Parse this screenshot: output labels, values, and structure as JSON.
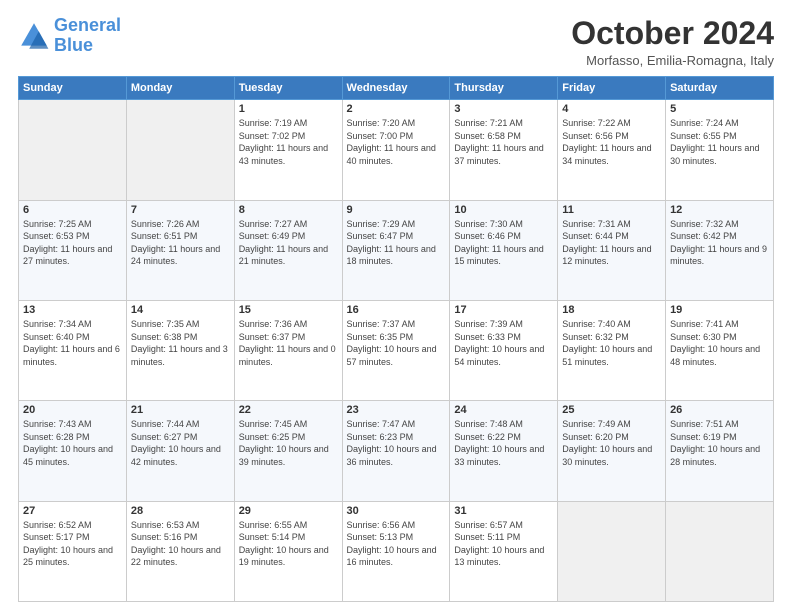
{
  "logo": {
    "line1": "General",
    "line2": "Blue"
  },
  "title": "October 2024",
  "location": "Morfasso, Emilia-Romagna, Italy",
  "weekdays": [
    "Sunday",
    "Monday",
    "Tuesday",
    "Wednesday",
    "Thursday",
    "Friday",
    "Saturday"
  ],
  "weeks": [
    [
      {
        "day": "",
        "sunrise": "",
        "sunset": "",
        "daylight": ""
      },
      {
        "day": "",
        "sunrise": "",
        "sunset": "",
        "daylight": ""
      },
      {
        "day": "1",
        "sunrise": "Sunrise: 7:19 AM",
        "sunset": "Sunset: 7:02 PM",
        "daylight": "Daylight: 11 hours and 43 minutes."
      },
      {
        "day": "2",
        "sunrise": "Sunrise: 7:20 AM",
        "sunset": "Sunset: 7:00 PM",
        "daylight": "Daylight: 11 hours and 40 minutes."
      },
      {
        "day": "3",
        "sunrise": "Sunrise: 7:21 AM",
        "sunset": "Sunset: 6:58 PM",
        "daylight": "Daylight: 11 hours and 37 minutes."
      },
      {
        "day": "4",
        "sunrise": "Sunrise: 7:22 AM",
        "sunset": "Sunset: 6:56 PM",
        "daylight": "Daylight: 11 hours and 34 minutes."
      },
      {
        "day": "5",
        "sunrise": "Sunrise: 7:24 AM",
        "sunset": "Sunset: 6:55 PM",
        "daylight": "Daylight: 11 hours and 30 minutes."
      }
    ],
    [
      {
        "day": "6",
        "sunrise": "Sunrise: 7:25 AM",
        "sunset": "Sunset: 6:53 PM",
        "daylight": "Daylight: 11 hours and 27 minutes."
      },
      {
        "day": "7",
        "sunrise": "Sunrise: 7:26 AM",
        "sunset": "Sunset: 6:51 PM",
        "daylight": "Daylight: 11 hours and 24 minutes."
      },
      {
        "day": "8",
        "sunrise": "Sunrise: 7:27 AM",
        "sunset": "Sunset: 6:49 PM",
        "daylight": "Daylight: 11 hours and 21 minutes."
      },
      {
        "day": "9",
        "sunrise": "Sunrise: 7:29 AM",
        "sunset": "Sunset: 6:47 PM",
        "daylight": "Daylight: 11 hours and 18 minutes."
      },
      {
        "day": "10",
        "sunrise": "Sunrise: 7:30 AM",
        "sunset": "Sunset: 6:46 PM",
        "daylight": "Daylight: 11 hours and 15 minutes."
      },
      {
        "day": "11",
        "sunrise": "Sunrise: 7:31 AM",
        "sunset": "Sunset: 6:44 PM",
        "daylight": "Daylight: 11 hours and 12 minutes."
      },
      {
        "day": "12",
        "sunrise": "Sunrise: 7:32 AM",
        "sunset": "Sunset: 6:42 PM",
        "daylight": "Daylight: 11 hours and 9 minutes."
      }
    ],
    [
      {
        "day": "13",
        "sunrise": "Sunrise: 7:34 AM",
        "sunset": "Sunset: 6:40 PM",
        "daylight": "Daylight: 11 hours and 6 minutes."
      },
      {
        "day": "14",
        "sunrise": "Sunrise: 7:35 AM",
        "sunset": "Sunset: 6:38 PM",
        "daylight": "Daylight: 11 hours and 3 minutes."
      },
      {
        "day": "15",
        "sunrise": "Sunrise: 7:36 AM",
        "sunset": "Sunset: 6:37 PM",
        "daylight": "Daylight: 11 hours and 0 minutes."
      },
      {
        "day": "16",
        "sunrise": "Sunrise: 7:37 AM",
        "sunset": "Sunset: 6:35 PM",
        "daylight": "Daylight: 10 hours and 57 minutes."
      },
      {
        "day": "17",
        "sunrise": "Sunrise: 7:39 AM",
        "sunset": "Sunset: 6:33 PM",
        "daylight": "Daylight: 10 hours and 54 minutes."
      },
      {
        "day": "18",
        "sunrise": "Sunrise: 7:40 AM",
        "sunset": "Sunset: 6:32 PM",
        "daylight": "Daylight: 10 hours and 51 minutes."
      },
      {
        "day": "19",
        "sunrise": "Sunrise: 7:41 AM",
        "sunset": "Sunset: 6:30 PM",
        "daylight": "Daylight: 10 hours and 48 minutes."
      }
    ],
    [
      {
        "day": "20",
        "sunrise": "Sunrise: 7:43 AM",
        "sunset": "Sunset: 6:28 PM",
        "daylight": "Daylight: 10 hours and 45 minutes."
      },
      {
        "day": "21",
        "sunrise": "Sunrise: 7:44 AM",
        "sunset": "Sunset: 6:27 PM",
        "daylight": "Daylight: 10 hours and 42 minutes."
      },
      {
        "day": "22",
        "sunrise": "Sunrise: 7:45 AM",
        "sunset": "Sunset: 6:25 PM",
        "daylight": "Daylight: 10 hours and 39 minutes."
      },
      {
        "day": "23",
        "sunrise": "Sunrise: 7:47 AM",
        "sunset": "Sunset: 6:23 PM",
        "daylight": "Daylight: 10 hours and 36 minutes."
      },
      {
        "day": "24",
        "sunrise": "Sunrise: 7:48 AM",
        "sunset": "Sunset: 6:22 PM",
        "daylight": "Daylight: 10 hours and 33 minutes."
      },
      {
        "day": "25",
        "sunrise": "Sunrise: 7:49 AM",
        "sunset": "Sunset: 6:20 PM",
        "daylight": "Daylight: 10 hours and 30 minutes."
      },
      {
        "day": "26",
        "sunrise": "Sunrise: 7:51 AM",
        "sunset": "Sunset: 6:19 PM",
        "daylight": "Daylight: 10 hours and 28 minutes."
      }
    ],
    [
      {
        "day": "27",
        "sunrise": "Sunrise: 6:52 AM",
        "sunset": "Sunset: 5:17 PM",
        "daylight": "Daylight: 10 hours and 25 minutes."
      },
      {
        "day": "28",
        "sunrise": "Sunrise: 6:53 AM",
        "sunset": "Sunset: 5:16 PM",
        "daylight": "Daylight: 10 hours and 22 minutes."
      },
      {
        "day": "29",
        "sunrise": "Sunrise: 6:55 AM",
        "sunset": "Sunset: 5:14 PM",
        "daylight": "Daylight: 10 hours and 19 minutes."
      },
      {
        "day": "30",
        "sunrise": "Sunrise: 6:56 AM",
        "sunset": "Sunset: 5:13 PM",
        "daylight": "Daylight: 10 hours and 16 minutes."
      },
      {
        "day": "31",
        "sunrise": "Sunrise: 6:57 AM",
        "sunset": "Sunset: 5:11 PM",
        "daylight": "Daylight: 10 hours and 13 minutes."
      },
      {
        "day": "",
        "sunrise": "",
        "sunset": "",
        "daylight": ""
      },
      {
        "day": "",
        "sunrise": "",
        "sunset": "",
        "daylight": ""
      }
    ]
  ]
}
